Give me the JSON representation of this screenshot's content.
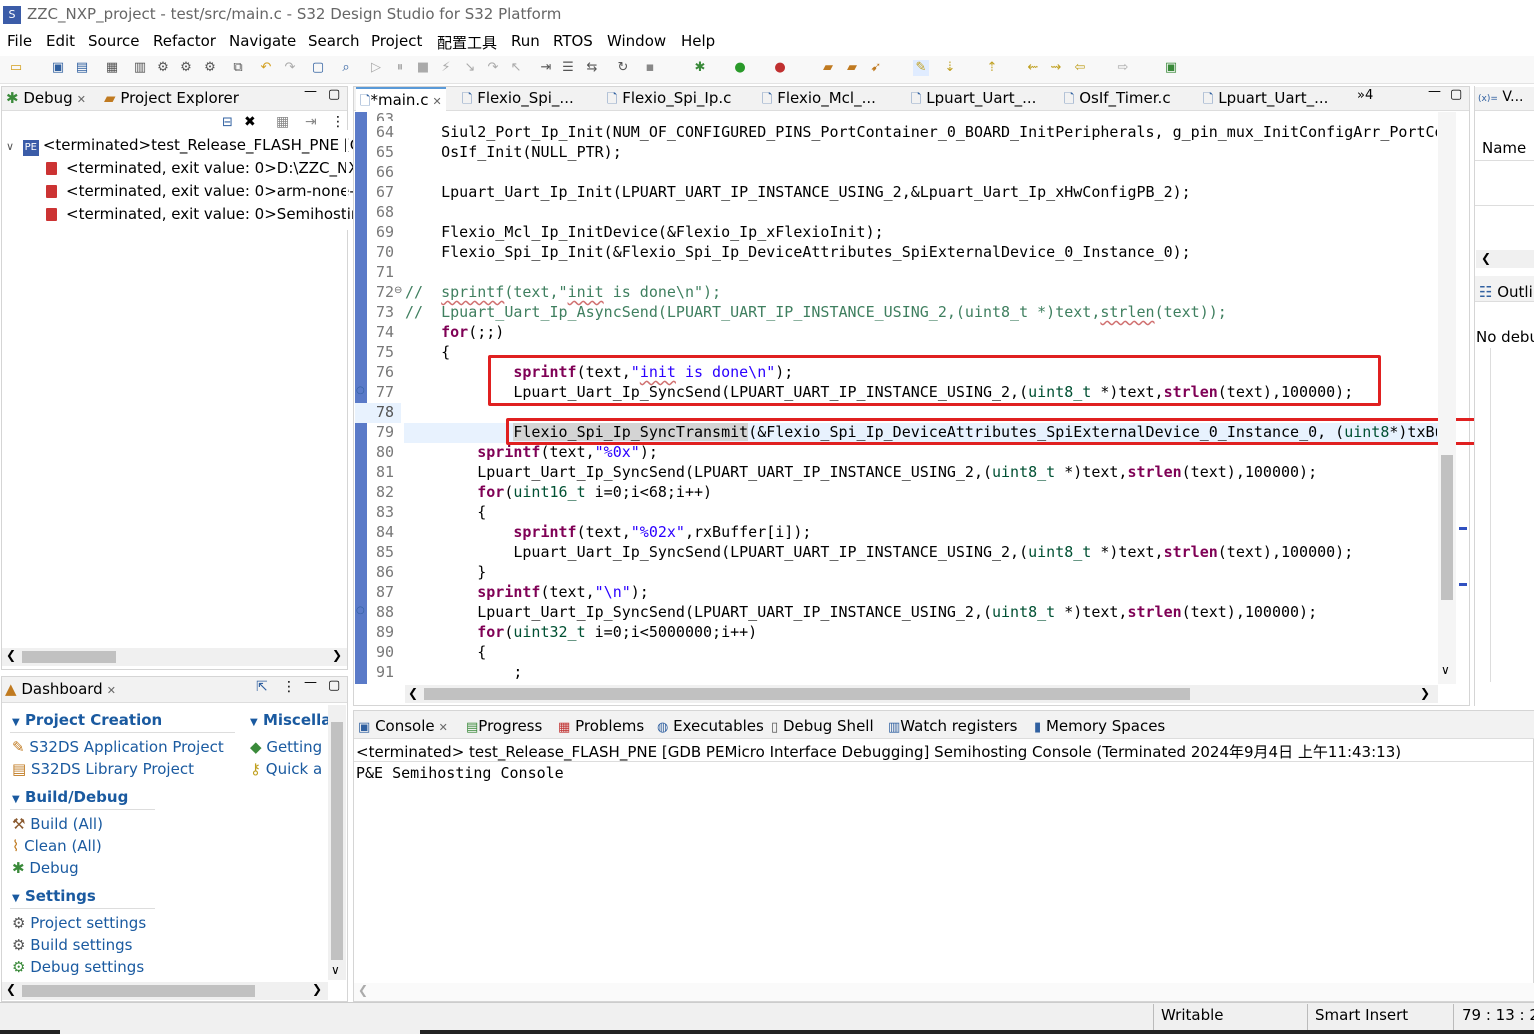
{
  "window": {
    "title": "ZZC_NXP_project - test/src/main.c - S32 Design Studio for S32 Platform"
  },
  "menu": [
    "File",
    "Edit",
    "Source",
    "Refactor",
    "Navigate",
    "Search",
    "Project",
    "配置工具",
    "Run",
    "RTOS",
    "Window",
    "Help"
  ],
  "left_top": {
    "tabs": [
      {
        "label": "Debug"
      },
      {
        "label": "Project Explorer"
      }
    ],
    "tree": {
      "root": "<terminated>test_Release_FLASH_PNE [G",
      "children": [
        "<terminated, exit value: 0>D:\\ZZC_NXP",
        "<terminated, exit value: 0>arm-none-e",
        "<terminated, exit value: 0>Semihosting"
      ]
    }
  },
  "dashboard": {
    "tab": "Dashboard",
    "sections": [
      {
        "title": "Project Creation",
        "items": [
          "S32DS Application Project",
          "S32DS Library Project"
        ]
      },
      {
        "title": "Build/Debug",
        "items": [
          "Build  (All)",
          "Clean  (All)",
          "Debug"
        ]
      },
      {
        "title": "Settings",
        "items": [
          "Project settings",
          "Build settings",
          "Debug settings"
        ]
      }
    ],
    "right_section": {
      "title": "Miscella",
      "items": [
        "Getting",
        "Quick a"
      ]
    }
  },
  "editor": {
    "tabs": [
      "*main.c",
      "Flexio_Spi_...",
      "Flexio_Spi_Ip.c",
      "Flexio_Mcl_...",
      "Lpuart_Uart_...",
      "OsIf_Timer.c",
      "Lpuart_Uart_..."
    ],
    "overflow": "»4",
    "first_line_partial": "63",
    "lines": [
      {
        "n": "64",
        "t": "    Siul2_Port_Ip_Init(NUM_OF_CONFIGURED_PINS_PortContainer_0_BOARD_InitPeripherals, g_pin_mux_InitConfigArr_PortCo"
      },
      {
        "n": "65",
        "t": "    OsIf_Init(NULL_PTR);"
      },
      {
        "n": "66",
        "t": ""
      },
      {
        "n": "67",
        "t": "    Lpuart_Uart_Ip_Init(LPUART_UART_IP_INSTANCE_USING_2,&Lpuart_Uart_Ip_xHwConfigPB_2);"
      },
      {
        "n": "68",
        "t": ""
      },
      {
        "n": "69",
        "t": "    Flexio_Mcl_Ip_InitDevice(&Flexio_Ip_xFlexioInit);"
      },
      {
        "n": "70",
        "t": "    Flexio_Spi_Ip_Init(&Flexio_Spi_Ip_DeviceAttributes_SpiExternalDevice_0_Instance_0);"
      },
      {
        "n": "71",
        "t": ""
      },
      {
        "n": "72",
        "t": "//  sprintf(text,\"init is done\\n\");"
      },
      {
        "n": "73",
        "t": "//  Lpuart_Uart_Ip_AsyncSend(LPUART_UART_IP_INSTANCE_USING_2,(uint8_t *)text,strlen(text));"
      },
      {
        "n": "74",
        "t": "    for(;;)"
      },
      {
        "n": "75",
        "t": "    {"
      },
      {
        "n": "76",
        "t": "            sprintf(text,\"init is done\\n\");"
      },
      {
        "n": "77",
        "t": "            Lpuart_Uart_Ip_SyncSend(LPUART_UART_IP_INSTANCE_USING_2,(uint8_t *)text,strlen(text),100000);"
      },
      {
        "n": "78",
        "t": ""
      },
      {
        "n": "79",
        "t": "            Flexio_Spi_Ip_SyncTransmit(&Flexio_Spi_Ip_DeviceAttributes_SpiExternalDevice_0_Instance_0, (uint8*)txBu"
      },
      {
        "n": "80",
        "t": "        sprintf(text,\"%0x\");"
      },
      {
        "n": "81",
        "t": "        Lpuart_Uart_Ip_SyncSend(LPUART_UART_IP_INSTANCE_USING_2,(uint8_t *)text,strlen(text),100000);"
      },
      {
        "n": "82",
        "t": "        for(uint16_t i=0;i<68;i++)"
      },
      {
        "n": "83",
        "t": "        {"
      },
      {
        "n": "84",
        "t": "            sprintf(text,\"%02x\",rxBuffer[i]);"
      },
      {
        "n": "85",
        "t": "            Lpuart_Uart_Ip_SyncSend(LPUART_UART_IP_INSTANCE_USING_2,(uint8_t *)text,strlen(text),100000);"
      },
      {
        "n": "86",
        "t": "        }"
      },
      {
        "n": "87",
        "t": "        sprintf(text,\"\\n\");"
      },
      {
        "n": "88",
        "t": "        Lpuart_Uart_Ip_SyncSend(LPUART_UART_IP_INSTANCE_USING_2,(uint8_t *)text,strlen(text),100000);"
      },
      {
        "n": "89",
        "t": "        for(uint32_t i=0;i<5000000;i++)"
      },
      {
        "n": "90",
        "t": "        {"
      },
      {
        "n": "91",
        "t": "            ;"
      }
    ]
  },
  "right_panel": {
    "tab": "V...",
    "name_col": "Name",
    "outline_tab": "Outli",
    "outline_text": "No debu"
  },
  "console": {
    "tabs": [
      "Console",
      "Progress",
      "Problems",
      "Executables",
      "Debug Shell",
      "Watch registers",
      "Memory Spaces"
    ],
    "header": "<terminated> test_Release_FLASH_PNE [GDB PEMicro Interface Debugging] Semihosting Console (Terminated 2024年9月4日 上午11:43:13)",
    "content": "P&E Semihosting Console"
  },
  "status": {
    "writable": "Writable",
    "insert": "Smart Insert",
    "position": "79 : 13 : 26"
  },
  "colors": {
    "highlight_box": "#e02020",
    "current_line": "#e8f2fe",
    "accent": "#1a5aa0"
  }
}
